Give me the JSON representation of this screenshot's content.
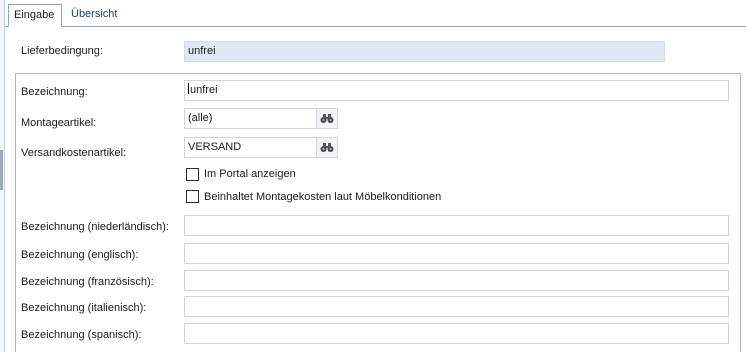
{
  "tabs": [
    {
      "label": "Eingabe",
      "active": true
    },
    {
      "label": "Übersicht",
      "active": false
    }
  ],
  "header": {
    "lieferbedingung_label": "Lieferbedingung:",
    "lieferbedingung_value": "unfrei"
  },
  "form": {
    "bezeichnung_label": "Bezeichnung:",
    "bezeichnung_value": "unfrei",
    "montageartikel_label": "Montageartikel:",
    "montageartikel_value": "(alle)",
    "versandkosten_label": "Versandkostenartikel:",
    "versandkosten_value": "VERSAND",
    "lookup_icon": "binoculars-icon",
    "checkbox_portal_label": "Im Portal anzeigen",
    "checkbox_portal_checked": false,
    "checkbox_montage_label": "Beinhaltet Montagekosten laut Möbelkonditionen",
    "checkbox_montage_checked": false,
    "bez_nl_label": "Bezeichnung (niederländisch):",
    "bez_nl_value": "",
    "bez_en_label": "Bezeichnung (englisch):",
    "bez_en_value": "",
    "bez_fr_label": "Bezeichnung (französisch):",
    "bez_fr_value": "",
    "bez_it_label": "Bezeichnung (italienisch):",
    "bez_it_value": "",
    "bez_es_label": "Bezeichnung (spanisch):",
    "bez_es_value": ""
  },
  "colors": {
    "readonly_background": "#dfe8f3",
    "tab_border": "#8fa6c0",
    "inactive_tab_text": "#1f3f7a"
  }
}
